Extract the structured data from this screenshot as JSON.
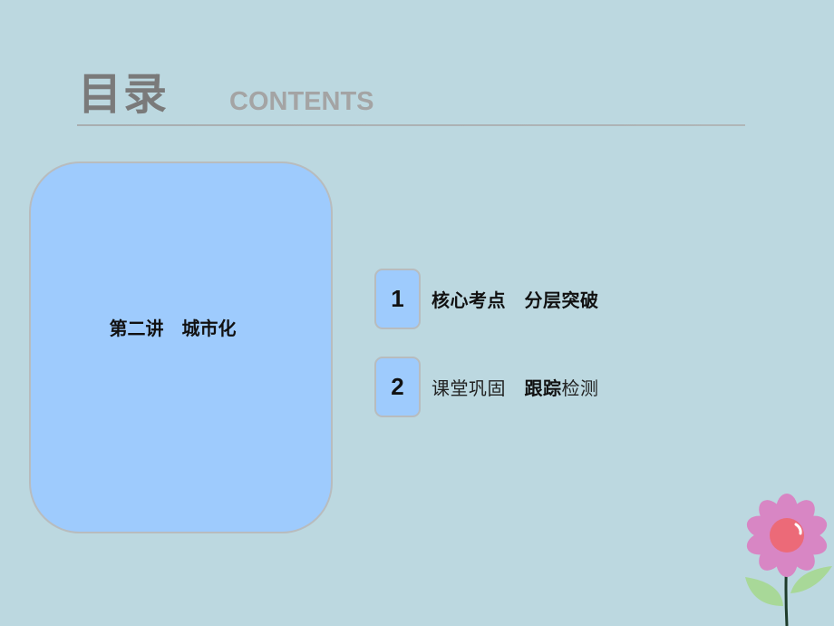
{
  "header": {
    "title": "目录",
    "subtitle": "CONTENTS"
  },
  "card": {
    "title": "第二讲　城市化"
  },
  "items": [
    {
      "number": "1",
      "part1": "核心考点",
      "separator": "　",
      "part2a": "分层突破",
      "part2b": ""
    },
    {
      "number": "2",
      "part1": "课堂巩固",
      "separator": "　",
      "part2a": "跟踪",
      "part2b": "检测"
    }
  ],
  "decoration": {
    "icon": "flower-icon"
  }
}
